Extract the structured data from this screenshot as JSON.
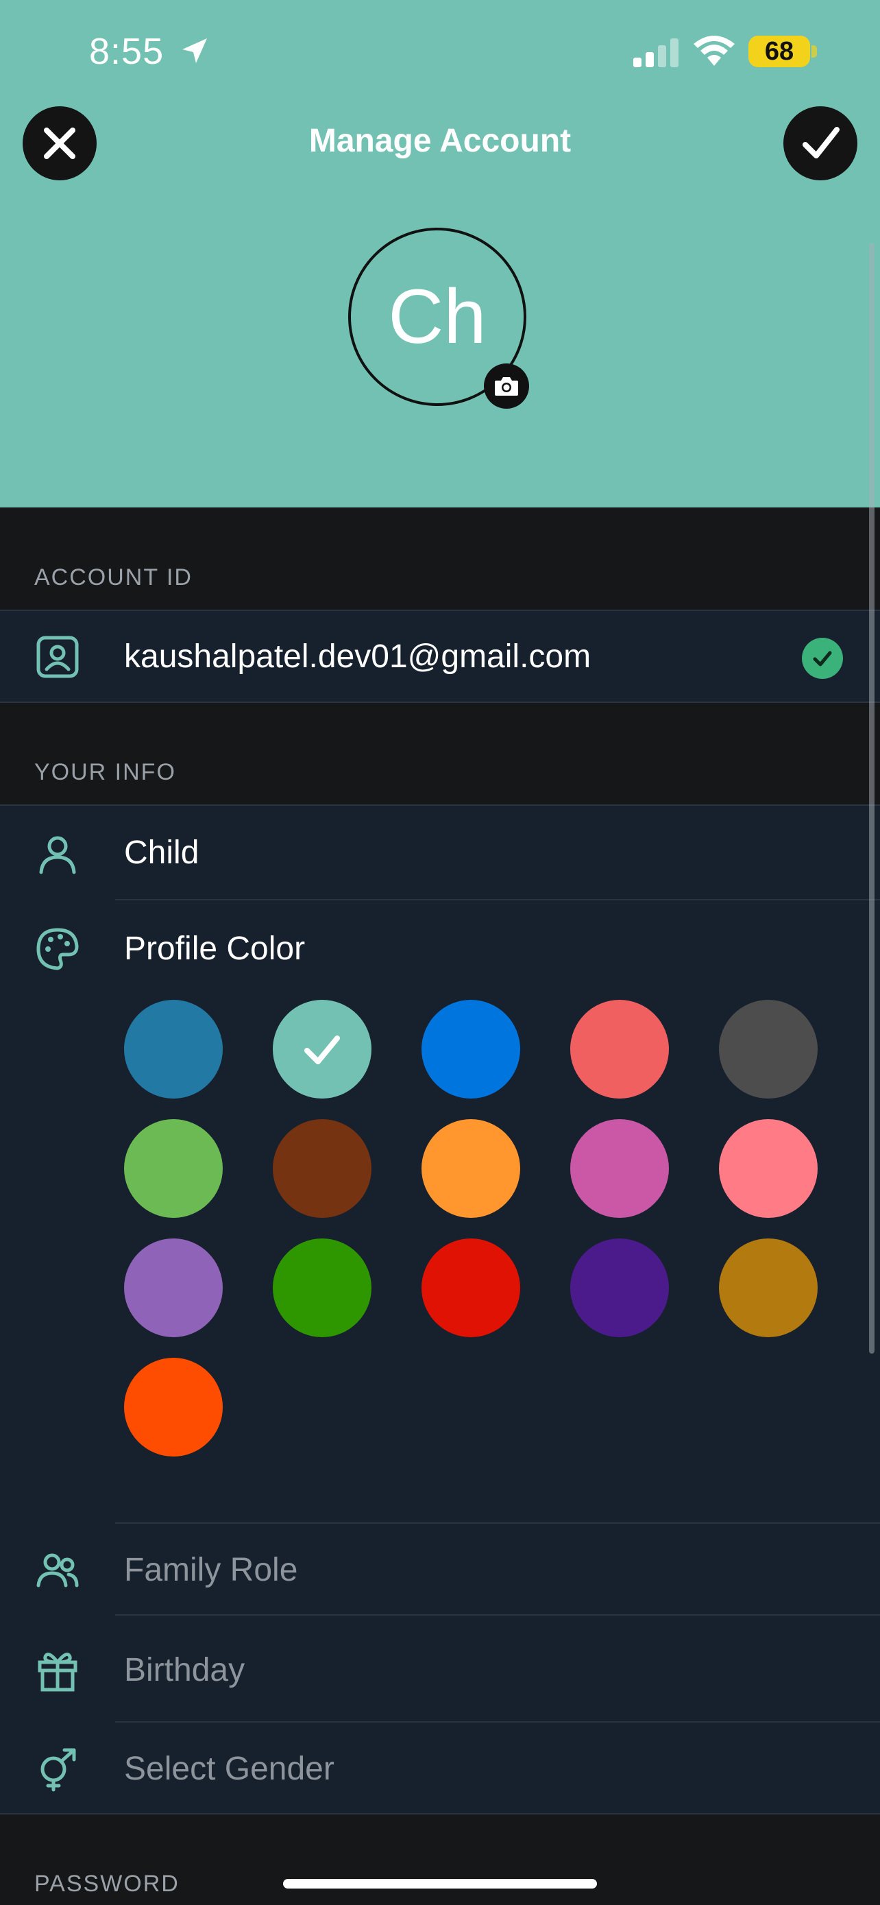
{
  "status_bar": {
    "time": "8:55",
    "battery": "68"
  },
  "header": {
    "title": "Manage Account",
    "close_icon": "close-icon",
    "confirm_icon": "check-icon",
    "avatar_initials": "Ch",
    "camera_icon": "camera-icon",
    "background_color": "#72c1b2"
  },
  "account_section": {
    "label": "ACCOUNT ID",
    "icon": "contact-card-icon",
    "email": "kaushalpatel.dev01@gmail.com",
    "verified_icon": "verified-check-icon"
  },
  "info_section": {
    "label": "YOUR INFO",
    "name": {
      "icon": "person-icon",
      "value": "Child"
    },
    "profile_color": {
      "icon": "palette-icon",
      "label": "Profile Color",
      "selected_index": 1,
      "colors": [
        "#2279a3",
        "#72c1b2",
        "#0075dd",
        "#f06060",
        "#4d4d4d",
        "#6bba53",
        "#763312",
        "#ff962e",
        "#ca58a7",
        "#ff7c87",
        "#8f63b8",
        "#2e9700",
        "#e01204",
        "#4b1b8c",
        "#b37a10",
        "#ff4d00"
      ]
    },
    "family_role": {
      "icon": "people-icon",
      "placeholder": "Family Role"
    },
    "birthday": {
      "icon": "gift-icon",
      "placeholder": "Birthday"
    },
    "gender": {
      "icon": "gender-icon",
      "placeholder": "Select Gender"
    }
  },
  "password_section": {
    "label": "PASSWORD"
  },
  "accent_color": "#72c1b2"
}
